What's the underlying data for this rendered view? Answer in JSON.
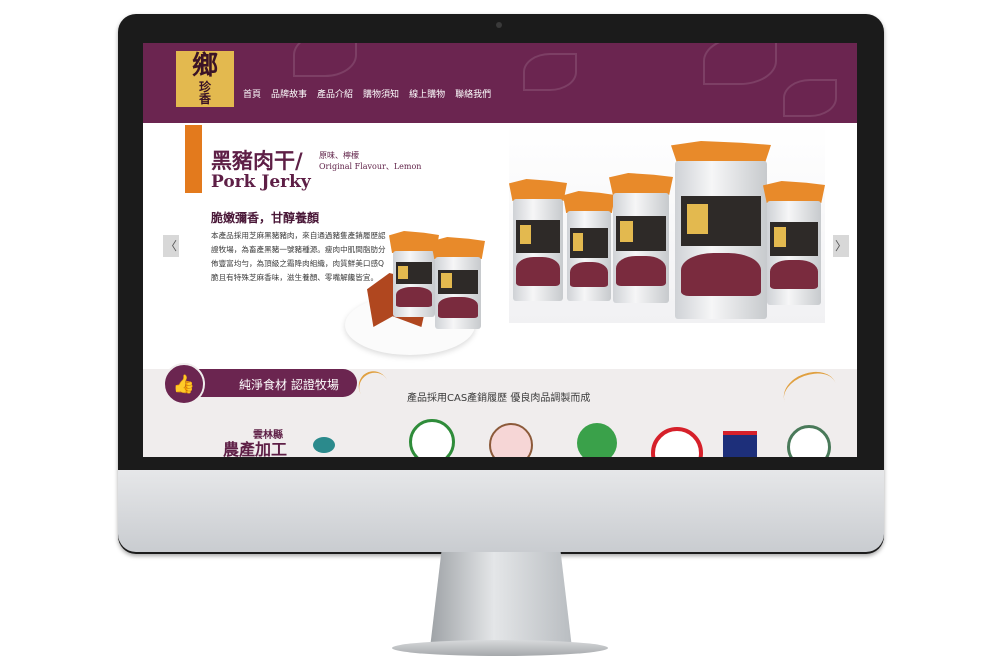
{
  "logo": {
    "lines": [
      "鄉",
      "珍",
      "香"
    ]
  },
  "nav": {
    "items": [
      "首頁",
      "品牌故事",
      "產品介紹",
      "購物須知",
      "線上購物",
      "聯絡我們"
    ]
  },
  "hero": {
    "title_zh": "黑豬肉干/",
    "flavor_zh": "原味、檸檬",
    "flavor_en": "Original Flavour、Lemon",
    "title_en": "Pork Jerky",
    "subtitle": "脆嫩彌香，甘醇養顏",
    "body": "本產品採用芝麻黑豬豬肉，來自通過豬隻產銷履歷認證牧場，為畜產黑豬一號豬種源。瘦肉中肌間脂肪分佈豐富均勻，為頂級之霜降肉組織，肉質鮮美口感Q脆且有特殊芝麻香味，滋生養顏、零嘴解饞皆宜。",
    "prev_glyph": "〈",
    "next_glyph": "〉"
  },
  "certification": {
    "banner_label": "純淨食材  認證牧場",
    "description": "產品採用CAS產銷履歷  優良肉品調製而成",
    "county": "雲林縣",
    "processing": "農產加工"
  },
  "colors": {
    "brand": "#6b2550",
    "accent": "#e37a1d",
    "logo_gold": "#e3b94f"
  },
  "icons": [
    "thumbs-up-icon",
    "chevron-left-icon",
    "chevron-right-icon"
  ]
}
